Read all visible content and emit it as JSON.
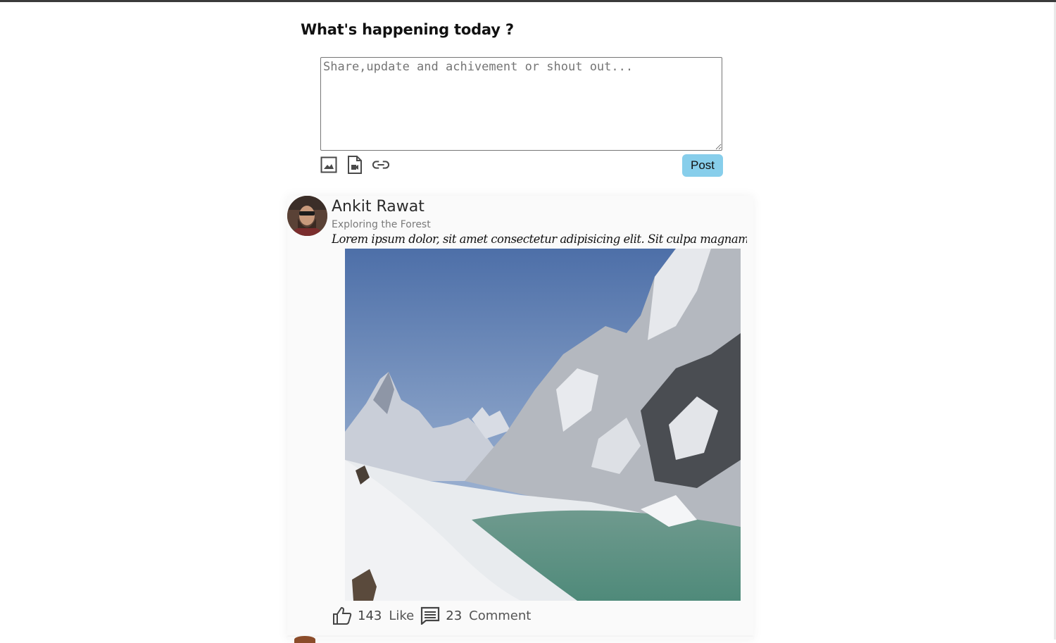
{
  "composer": {
    "title": "What's happening today ?",
    "placeholder": "Share,update and achivement or shout out...",
    "value": "",
    "tools": [
      "image-icon",
      "document-icon",
      "link-icon"
    ],
    "post_label": "Post",
    "post_color": "#87ceeb"
  },
  "post": {
    "author": "Ankit Rawat",
    "subtitle": "Exploring the Forest",
    "text": "Lorem ipsum dolor, sit amet consectetur adipisicing elit. Sit culpa magnam dolo...",
    "likes": "143",
    "like_label": "Like",
    "comments": "23",
    "comment_label": "Comment"
  }
}
